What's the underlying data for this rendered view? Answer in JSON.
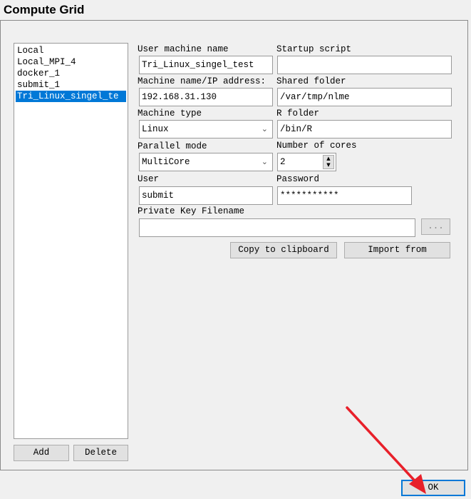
{
  "window": {
    "title": "Compute Grid"
  },
  "machines": {
    "items": [
      "Local",
      "Local_MPI_4",
      "docker_1",
      "submit_1",
      "Tri_Linux_singel_te"
    ],
    "selected_index": 4,
    "add_label": "Add",
    "delete_label": "Delete"
  },
  "form": {
    "user_machine_name": {
      "label": "User machine name",
      "value": "Tri_Linux_singel_test"
    },
    "startup_script": {
      "label": "Startup script",
      "value": ""
    },
    "machine_ip": {
      "label": "Machine name/IP address:",
      "value": "192.168.31.130"
    },
    "shared_folder": {
      "label": "Shared folder",
      "value": "/var/tmp/nlme"
    },
    "machine_type": {
      "label": "Machine type",
      "value": "Linux"
    },
    "r_folder": {
      "label": "R folder",
      "value": "/bin/R"
    },
    "parallel_mode": {
      "label": "Parallel mode",
      "value": "MultiCore"
    },
    "num_cores": {
      "label": "Number of cores",
      "value": "2"
    },
    "user": {
      "label": "User",
      "value": "submit"
    },
    "password": {
      "label": "Password",
      "value": "***********"
    },
    "private_key": {
      "label": "Private Key Filename",
      "value": "",
      "browse_label": "..."
    },
    "copy_label": "Copy to clipboard",
    "import_label": "Import from"
  },
  "ok_label": "OK",
  "annotation": {
    "arrow_color": "#e8202a"
  }
}
